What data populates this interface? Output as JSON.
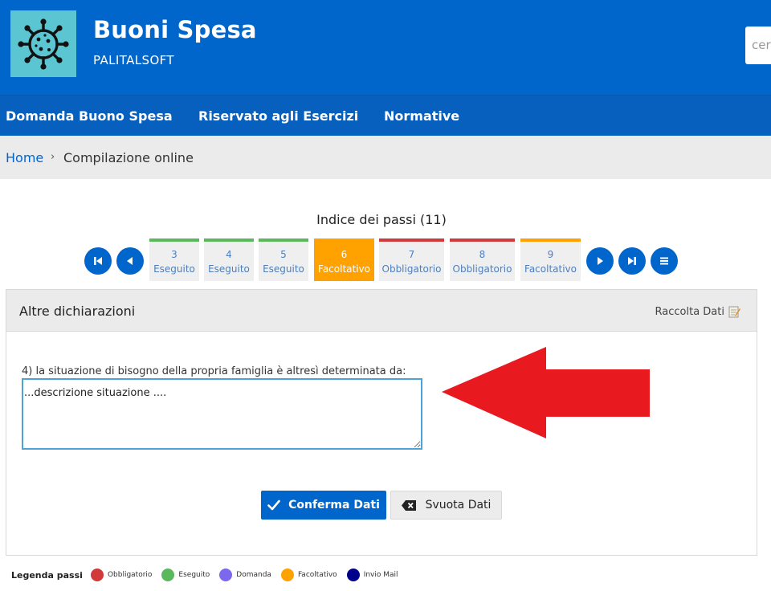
{
  "header": {
    "title": "Buoni Spesa",
    "subtitle": "PALITALSOFT",
    "search_placeholder": "cer",
    "logo_icon": "virus-icon"
  },
  "nav": {
    "items": [
      {
        "label": "Domanda Buono Spesa"
      },
      {
        "label": "Riservato agli Esercizi"
      },
      {
        "label": "Normative"
      }
    ]
  },
  "breadcrumb": {
    "home": "Home",
    "separator": "›",
    "current": "Compilazione online"
  },
  "steps": {
    "title": "Indice dei passi (11)",
    "items": [
      {
        "num": "3",
        "label": "Eseguito",
        "color": "#5cb85c"
      },
      {
        "num": "4",
        "label": "Eseguito",
        "color": "#5cb85c"
      },
      {
        "num": "5",
        "label": "Eseguito",
        "color": "#5cb85c"
      },
      {
        "num": "6",
        "label": "Facoltativo",
        "color": "#ffa200",
        "active": true
      },
      {
        "num": "7",
        "label": "Obbligatorio",
        "color": "#d03a3a"
      },
      {
        "num": "8",
        "label": "Obbligatorio",
        "color": "#d03a3a"
      },
      {
        "num": "9",
        "label": "Facoltativo",
        "color": "#ffa200"
      }
    ]
  },
  "panel": {
    "title": "Altre dichiarazioni",
    "right_label": "Raccolta Dati",
    "question": "4) la situazione di bisogno della propria famiglia è altresì determinata da:",
    "textarea_value": "...descrizione situazione ....",
    "confirm_label": "Conferma Dati",
    "clear_label": "Svuota Dati"
  },
  "legend": {
    "title": "Legenda passi",
    "items": [
      {
        "label": "Obbligatorio",
        "color": "#d03a3a"
      },
      {
        "label": "Eseguito",
        "color": "#5cb85c"
      },
      {
        "label": "Domanda",
        "color": "#7b68ee"
      },
      {
        "label": "Facoltativo",
        "color": "#ffa200"
      },
      {
        "label": "Invio Mail",
        "color": "#00008b"
      }
    ]
  },
  "colors": {
    "primary": "#0066cc",
    "nav": "#0760bd",
    "arrow": "#e8191f"
  }
}
